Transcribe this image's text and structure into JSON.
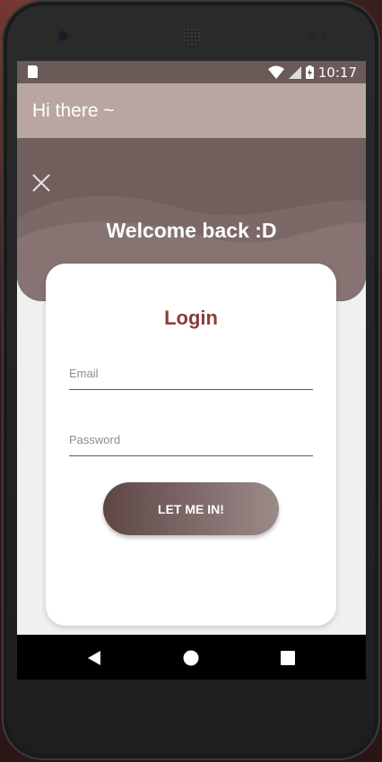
{
  "status_bar": {
    "time": "10:17",
    "icons": [
      "sd-card-icon",
      "wifi-icon",
      "signal-icon",
      "battery-charging-icon"
    ]
  },
  "app_bar": {
    "title": "Hi there ~"
  },
  "hero": {
    "close_icon": "close-icon",
    "welcome": "Welcome back :D"
  },
  "login_card": {
    "title": "Login",
    "email": {
      "placeholder": "Email",
      "value": ""
    },
    "password": {
      "placeholder": "Password",
      "value": ""
    },
    "submit_label": "LET ME IN!"
  },
  "nav_bar": {
    "icons": [
      "back-icon",
      "home-icon",
      "recents-icon"
    ]
  },
  "colors": {
    "status_bar": "#6a5a58",
    "app_bar": "#b9a6a0",
    "hero": "#715f5e",
    "title_accent": "#8b3d3a",
    "button_gradient_start": "#5e4646",
    "button_gradient_end": "#9c8a89",
    "screen_background": "#f0f0f0"
  }
}
